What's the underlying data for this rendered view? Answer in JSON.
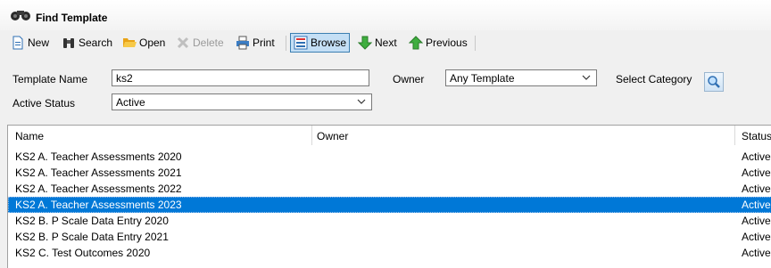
{
  "window": {
    "title": "Find Template",
    "icon": "binoculars-icon"
  },
  "toolbar": {
    "new": "New",
    "search": "Search",
    "open": "Open",
    "delete": "Delete",
    "print": "Print",
    "browse": "Browse",
    "next": "Next",
    "previous": "Previous"
  },
  "filters": {
    "template_name_label": "Template Name",
    "template_name_value": "ks2",
    "owner_label": "Owner",
    "owner_value": "Any Template",
    "select_category_label": "Select Category",
    "active_status_label": "Active Status",
    "active_status_value": "Active"
  },
  "grid": {
    "columns": [
      "Name",
      "Owner",
      "Status"
    ],
    "rows": [
      {
        "name": "KS2 A. Teacher Assessments 2020",
        "owner": "",
        "status": "Active"
      },
      {
        "name": "KS2 A. Teacher Assessments 2021",
        "owner": "",
        "status": "Active"
      },
      {
        "name": "KS2 A. Teacher Assessments 2022",
        "owner": "",
        "status": "Active"
      },
      {
        "name": "KS2 A. Teacher Assessments 2023",
        "owner": "",
        "status": "Active",
        "selected": true
      },
      {
        "name": "KS2 B. P Scale Data Entry 2020",
        "owner": "",
        "status": "Active"
      },
      {
        "name": "KS2 B. P Scale Data Entry 2021",
        "owner": "",
        "status": "Active"
      },
      {
        "name": "KS2 C. Test Outcomes 2020",
        "owner": "",
        "status": "Active"
      }
    ]
  },
  "colors": {
    "selection": "#0078d7",
    "accent": "#3c7fb1"
  }
}
